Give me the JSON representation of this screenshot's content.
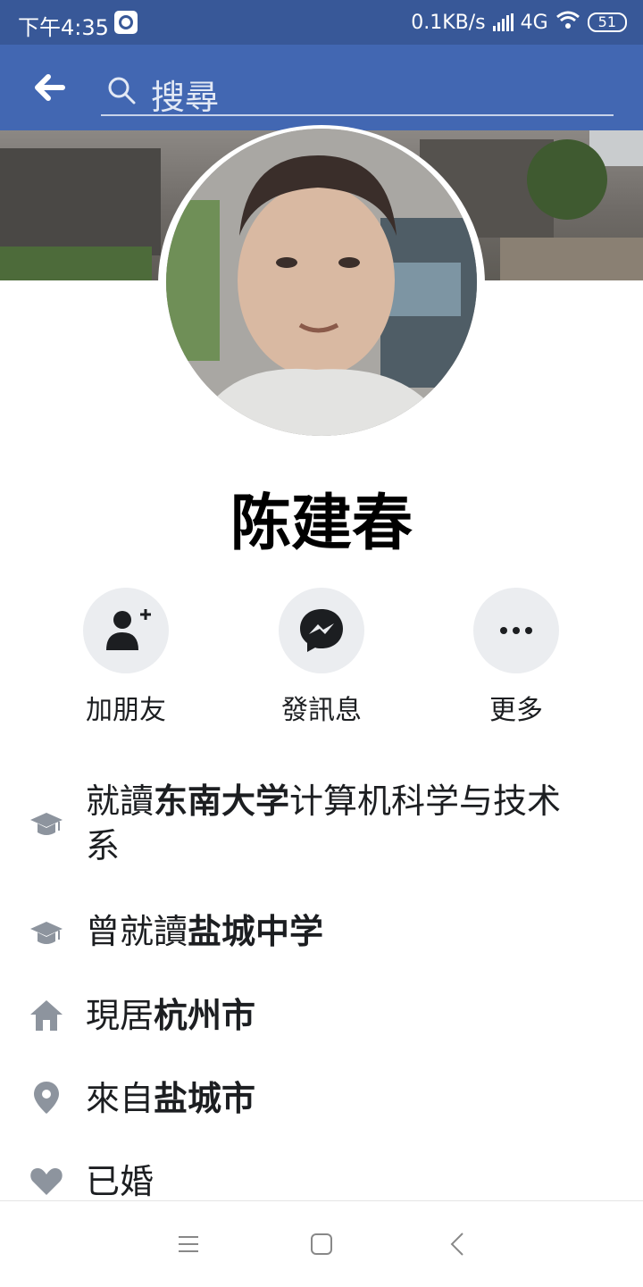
{
  "status_bar": {
    "time": "下午4:35",
    "net_speed": "0.1KB/s",
    "network": "4G",
    "battery": "51"
  },
  "header": {
    "search_placeholder": "搜尋"
  },
  "profile": {
    "name": "陈建春"
  },
  "actions": [
    {
      "label": "加朋友",
      "icon": "add-friend-icon"
    },
    {
      "label": "發訊息",
      "icon": "messenger-icon"
    },
    {
      "label": "更多",
      "icon": "more-icon"
    }
  ],
  "intro": {
    "education": {
      "prefix": "就讀",
      "highlight": "东南大学",
      "suffix": "计算机科学与技术系"
    },
    "past_education": {
      "prefix": "曾就讀",
      "highlight": "盐城中学"
    },
    "lives_in": {
      "prefix": "現居",
      "highlight": "杭州市"
    },
    "from": {
      "prefix": "來自",
      "highlight": "盐城市"
    },
    "relationship": {
      "text": "已婚"
    }
  },
  "colors": {
    "status_bar": "#385898",
    "brand_blue": "#4267b2",
    "icon_gray": "#8d949e",
    "button_bg": "#ebedf0"
  }
}
